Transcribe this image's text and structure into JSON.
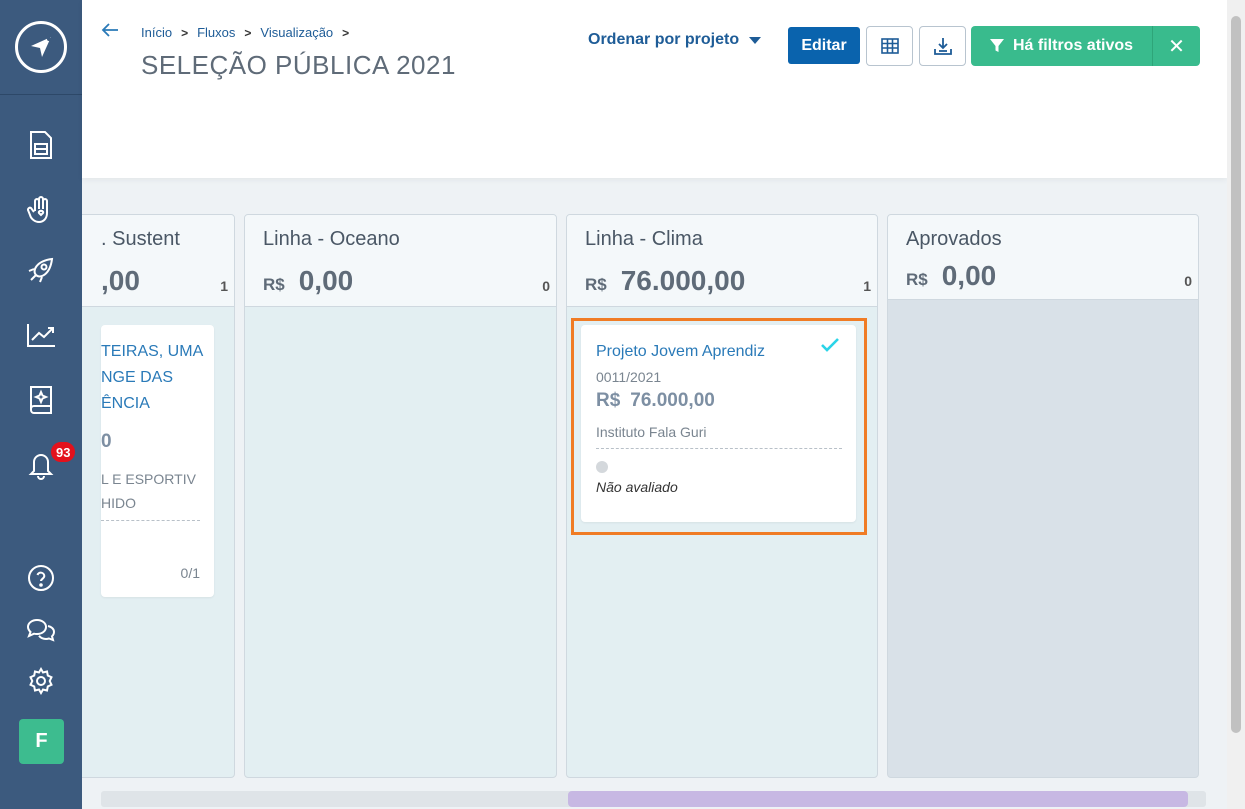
{
  "sidebar": {
    "notification_count": "93",
    "avatar_initial": "F"
  },
  "header": {
    "breadcrumb": [
      "Início",
      "Fluxos",
      "Visualização"
    ],
    "title": "SELEÇÃO PÚBLICA 2021",
    "sort_label": "Ordenar por projeto",
    "edit_label": "Editar",
    "filter_label": "Há filtros ativos",
    "filter_close": "✕"
  },
  "columns": [
    {
      "title": ". Sustent",
      "currency": "",
      "amount": ",00",
      "count": "1",
      "card": {
        "title_lines": [
          "TEIRAS, UMA",
          "NGE DAS",
          "ÊNCIA"
        ],
        "value_partial": "0",
        "inst_lines": [
          "L E ESPORTIV",
          "HIDO"
        ],
        "progress": "0/1"
      }
    },
    {
      "title": "Linha - Oceano",
      "currency": "R$",
      "amount": "0,00",
      "count": "0"
    },
    {
      "title": "Linha - Clima",
      "currency": "R$",
      "amount": "76.000,00",
      "count": "1",
      "card": {
        "title": "Projeto Jovem Aprendiz",
        "code": "0011/2021",
        "currency": "R$",
        "value": "76.000,00",
        "institution": "Instituto Fala Guri",
        "status": "Não avaliado"
      }
    },
    {
      "title": "Aprovados",
      "currency": "R$",
      "amount": "0,00",
      "count": "0"
    }
  ],
  "colors": {
    "sidebar": "#3c5a7e",
    "primary": "#0a63ad",
    "success": "#39bb8d",
    "highlight": "#f07c25",
    "badge": "#e3111c"
  }
}
